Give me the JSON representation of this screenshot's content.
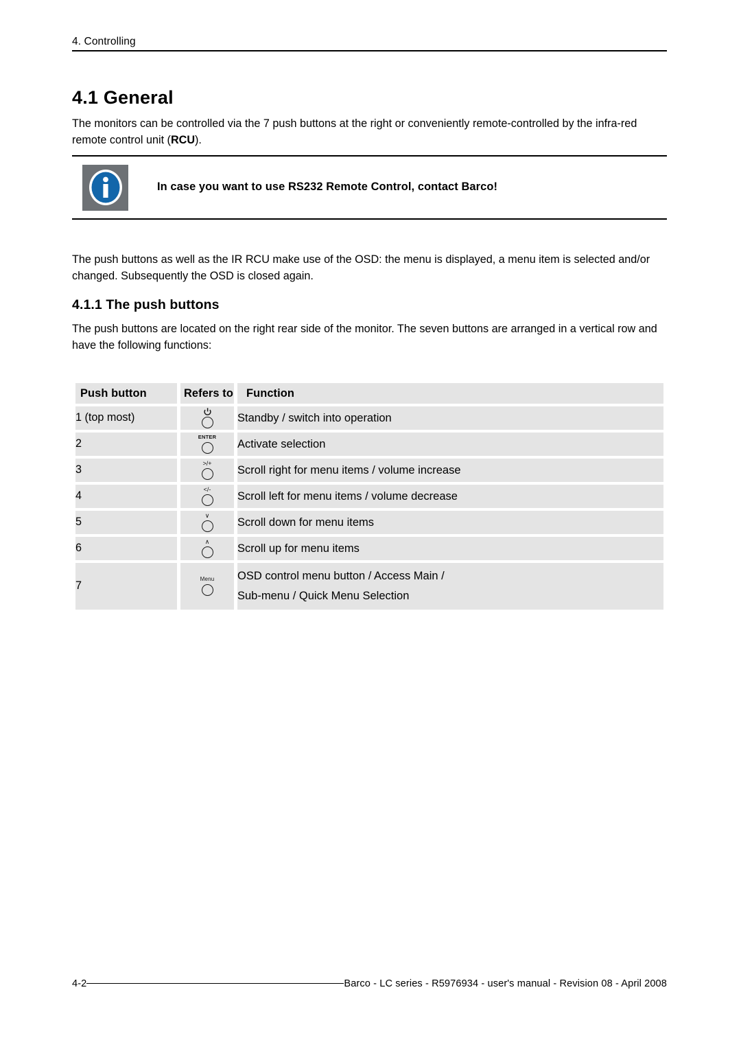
{
  "running_header": {
    "chapter": "4. Controlling"
  },
  "headings": {
    "section": "4.1 General",
    "subsection": "4.1.1 The push buttons"
  },
  "paragraphs": {
    "intro_before": "The monitors can be controlled via the 7 push buttons at the right or conveniently remote-controlled by the infra-red remote control unit (",
    "intro_bold": "RCU",
    "intro_after": ").",
    "osd": "The push buttons as well as the IR RCU make use of the OSD: the menu is displayed, a menu item is selected and/or changed. Subsequently the OSD is closed again.",
    "location": "The push buttons are located on the right rear side of the monitor. The seven buttons are arranged in a vertical row and have the following functions:"
  },
  "notebox": {
    "icon_name": "info-icon",
    "text": "In case you want to use RS232 Remote Control, contact Barco!",
    "icon_bg": "#6d7175",
    "icon_circle": "#1266aa"
  },
  "table": {
    "headers": [
      "Push button",
      "Refers to",
      "Function"
    ],
    "rows": [
      {
        "number": "1 (top most)",
        "glyph_label": "",
        "glyph_type": "power",
        "glyph_name": "power-standby-button-icon",
        "function": [
          "Standby / switch into operation"
        ]
      },
      {
        "number": "2",
        "glyph_label": "ENTER",
        "glyph_type": "text",
        "glyph_name": "enter-button-icon",
        "function": [
          "Activate selection"
        ]
      },
      {
        "number": "3",
        "glyph_label": ">/+",
        "glyph_type": "sym",
        "glyph_name": "scroll-right-button-icon",
        "function": [
          "Scroll right for menu items / volume increase"
        ]
      },
      {
        "number": "4",
        "glyph_label": "</-",
        "glyph_type": "sym",
        "glyph_name": "scroll-left-button-icon",
        "function": [
          "Scroll left for menu items / volume decrease"
        ]
      },
      {
        "number": "5",
        "glyph_label": "∨",
        "glyph_type": "sym",
        "glyph_name": "scroll-down-button-icon",
        "function": [
          "Scroll down for menu items"
        ]
      },
      {
        "number": "6",
        "glyph_label": "∧",
        "glyph_type": "sym",
        "glyph_name": "scroll-up-button-icon",
        "function": [
          "Scroll up for menu items"
        ]
      },
      {
        "number": "7",
        "glyph_label": "Menu",
        "glyph_type": "menu",
        "glyph_name": "menu-button-icon",
        "function": [
          "OSD control menu button / Access Main /",
          "Sub-menu / Quick Menu Selection"
        ]
      }
    ]
  },
  "footer": {
    "page_number": "4-2",
    "meta": "Barco - LC series - R5976934 - user's manual - Revision 08 - April 2008"
  }
}
